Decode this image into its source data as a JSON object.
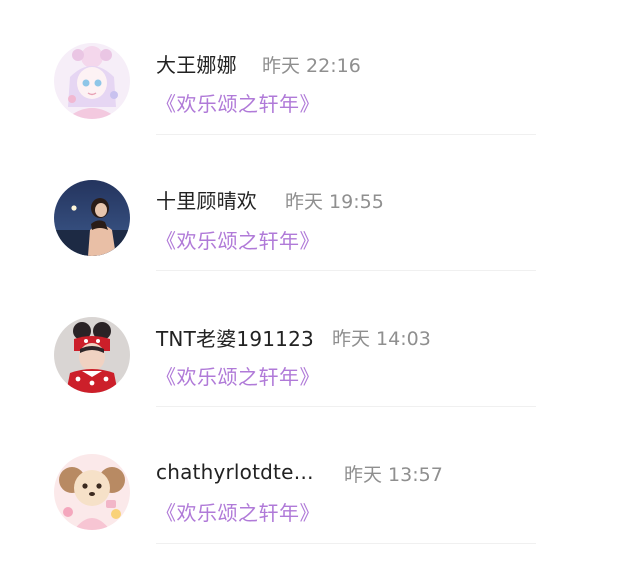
{
  "comments": [
    {
      "user": "大王娜娜",
      "time": "昨天 22:16",
      "work": "《欢乐颂之轩年》",
      "avatar_icon": "anime-girl-avatar"
    },
    {
      "user": "十里顾晴欢",
      "time": "昨天 19:55",
      "work": "《欢乐颂之轩年》",
      "avatar_icon": "moon-photo-avatar"
    },
    {
      "user": "TNT老婆191123",
      "time": "昨天 14:03",
      "work": "《欢乐颂之轩年》",
      "avatar_icon": "boy-minnie-ears-avatar"
    },
    {
      "user": "chathyrlotdte…",
      "time": "昨天 13:57",
      "work": "《欢乐颂之轩年》",
      "avatar_icon": "cartoon-dog-avatar"
    }
  ],
  "colors": {
    "work_link": "#b07ad8",
    "username": "#222222",
    "timestamp": "#8f8f8f",
    "divider": "#f0f0f0"
  }
}
